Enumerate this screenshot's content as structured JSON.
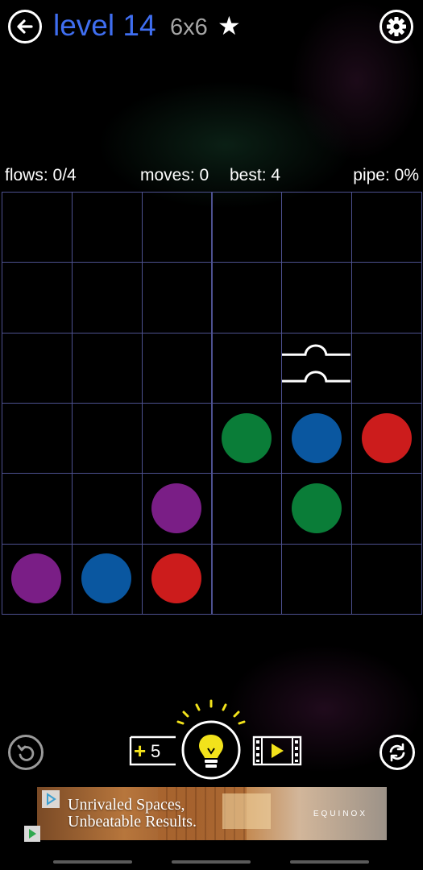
{
  "header": {
    "title": "level 14",
    "size": "6x6",
    "star": "★",
    "back_icon": "back-arrow-icon",
    "settings_icon": "gear-icon"
  },
  "stats": {
    "flows": "flows: 0/4",
    "moves": "moves: 0",
    "best": "best: 4",
    "pipe": "pipe: 0%"
  },
  "board": {
    "rows": 6,
    "cols": 6,
    "grid_color": "#4d5190",
    "bridge": {
      "row": 2,
      "col": 4
    },
    "dots": [
      {
        "row": 3,
        "col": 3,
        "color": "#0a7d38"
      },
      {
        "row": 3,
        "col": 4,
        "color": "#0a57a0"
      },
      {
        "row": 3,
        "col": 5,
        "color": "#cc1c1c"
      },
      {
        "row": 4,
        "col": 2,
        "color": "#7a1e86"
      },
      {
        "row": 4,
        "col": 4,
        "color": "#0a7d38"
      },
      {
        "row": 5,
        "col": 0,
        "color": "#7a1e86"
      },
      {
        "row": 5,
        "col": 1,
        "color": "#0a57a0"
      },
      {
        "row": 5,
        "col": 2,
        "color": "#cc1c1c"
      }
    ]
  },
  "controls": {
    "hints_label": "+",
    "hints_count": "5",
    "undo_icon": "undo-icon",
    "hint_icon": "lightbulb-icon",
    "video_icon": "video-play-icon",
    "restart_icon": "refresh-icon"
  },
  "ad": {
    "line1": "Unrivaled Spaces,",
    "line2": "Unbeatable Results.",
    "brand": "EQUINOX"
  },
  "colors": {
    "title": "#3f6ef0",
    "size_label": "#a6a6a6",
    "hint_yellow": "#f2e21b"
  }
}
